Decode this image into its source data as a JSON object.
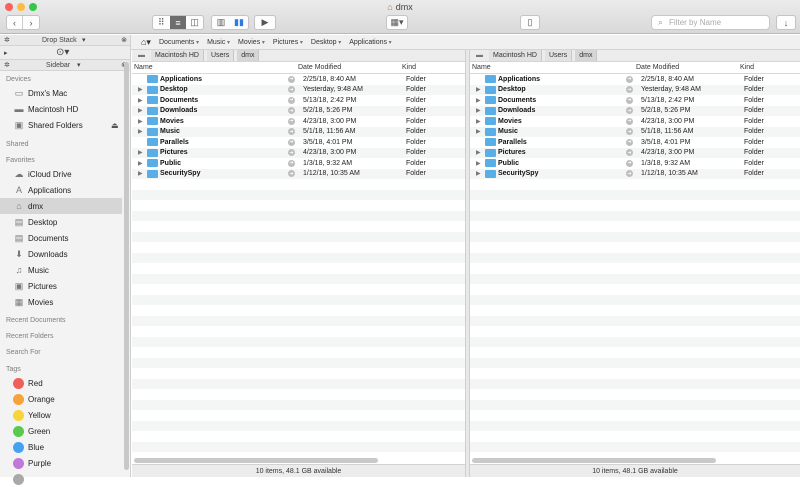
{
  "window": {
    "title": "dmx"
  },
  "toolbar": {
    "search_placeholder": "Filter by Name",
    "back": "‹",
    "forward": "›"
  },
  "sidebar": {
    "dropstack_label": "Drop Stack",
    "sidebar_label": "Sidebar",
    "devices_header": "Devices",
    "devices": [
      {
        "label": "Dmx's Mac",
        "icon": "computer-icon"
      },
      {
        "label": "Macintosh HD",
        "icon": "drive-icon"
      },
      {
        "label": "Shared Folders",
        "icon": "shared-folder-icon"
      }
    ],
    "shared_header": "Shared",
    "favorites_header": "Favorites",
    "favorites": [
      {
        "label": "iCloud Drive",
        "icon": "cloud-icon"
      },
      {
        "label": "Applications",
        "icon": "applications-icon"
      },
      {
        "label": "dmx",
        "icon": "home-icon",
        "selected": true
      },
      {
        "label": "Desktop",
        "icon": "desktop-icon"
      },
      {
        "label": "Documents",
        "icon": "documents-icon"
      },
      {
        "label": "Downloads",
        "icon": "downloads-icon"
      },
      {
        "label": "Music",
        "icon": "music-icon"
      },
      {
        "label": "Pictures",
        "icon": "pictures-icon"
      },
      {
        "label": "Movies",
        "icon": "movies-icon"
      }
    ],
    "recent_documents_header": "Recent Documents",
    "recent_folders_header": "Recent Folders",
    "search_for_header": "Search For",
    "tags_header": "Tags",
    "tags": [
      {
        "label": "Red",
        "color": "#f0605a"
      },
      {
        "label": "Orange",
        "color": "#f5a33a"
      },
      {
        "label": "Yellow",
        "color": "#f6d43c"
      },
      {
        "label": "Green",
        "color": "#5bc94f"
      },
      {
        "label": "Blue",
        "color": "#45a2f0"
      },
      {
        "label": "Purple",
        "color": "#c079d8"
      }
    ]
  },
  "favbar": [
    "Documents",
    "Music",
    "Movies",
    "Pictures",
    "Desktop",
    "Applications"
  ],
  "path": [
    "Macintosh HD",
    "Users",
    "dmx"
  ],
  "columns": {
    "name": "Name",
    "date": "Date Modified",
    "kind": "Kind"
  },
  "files": [
    {
      "name": "Applications",
      "date": "2/25/18, 8:40 AM",
      "kind": "Folder",
      "expandable": false
    },
    {
      "name": "Desktop",
      "date": "Yesterday, 9:48 AM",
      "kind": "Folder",
      "expandable": true
    },
    {
      "name": "Documents",
      "date": "5/13/18, 2:42 PM",
      "kind": "Folder",
      "expandable": true
    },
    {
      "name": "Downloads",
      "date": "5/2/18, 5:26 PM",
      "kind": "Folder",
      "expandable": true
    },
    {
      "name": "Movies",
      "date": "4/23/18, 3:00 PM",
      "kind": "Folder",
      "expandable": true
    },
    {
      "name": "Music",
      "date": "5/1/18, 11:56 AM",
      "kind": "Folder",
      "expandable": true
    },
    {
      "name": "Parallels",
      "date": "3/5/18, 4:01 PM",
      "kind": "Folder",
      "expandable": false
    },
    {
      "name": "Pictures",
      "date": "4/23/18, 3:00 PM",
      "kind": "Folder",
      "expandable": true
    },
    {
      "name": "Public",
      "date": "1/3/18, 9:32 AM",
      "kind": "Folder",
      "expandable": true
    },
    {
      "name": "SecuritySpy",
      "date": "1/12/18, 10:35 AM",
      "kind": "Folder",
      "expandable": true
    }
  ],
  "status": "10 items, 48.1 GB available"
}
